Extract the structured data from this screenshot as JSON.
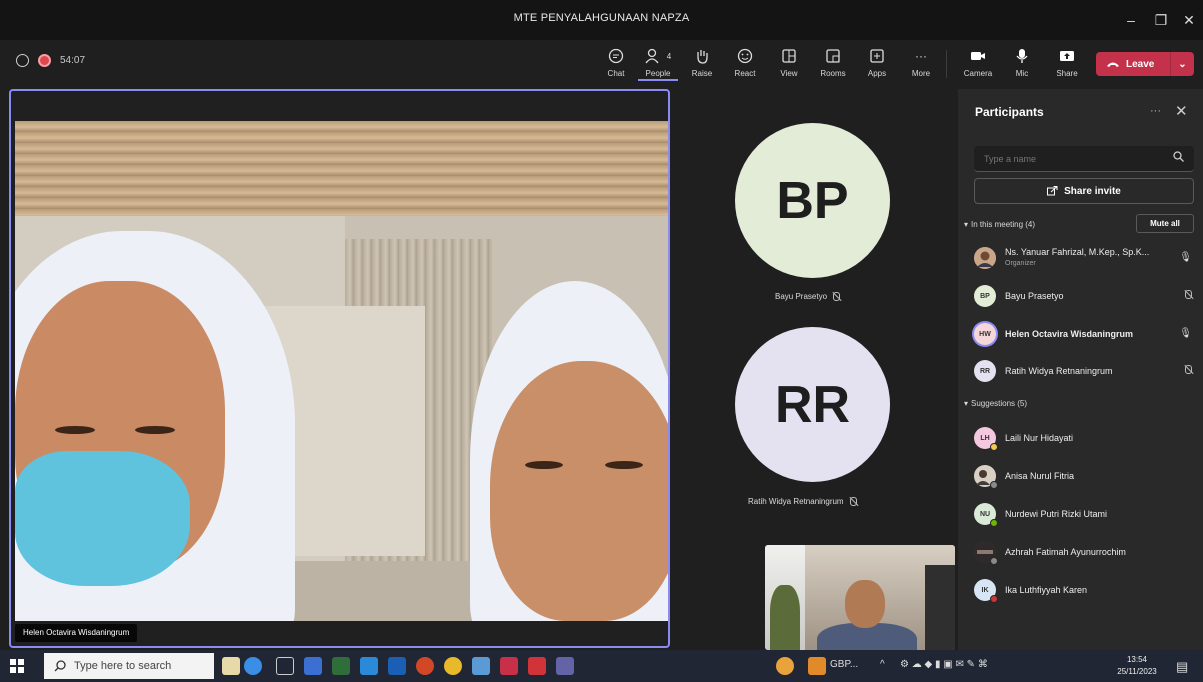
{
  "window": {
    "title": "MTE PENYALAHGUNAAN NAPZA",
    "minimize": "–",
    "maximize": "❐",
    "close": "✕"
  },
  "toolbar": {
    "timer": "54:07",
    "buttons": {
      "chat": "Chat",
      "people": "People",
      "people_count": "4",
      "raise": "Raise",
      "react": "React",
      "view": "View",
      "rooms": "Rooms",
      "apps": "Apps",
      "more": "More",
      "camera": "Camera",
      "mic": "Mic",
      "share": "Share"
    },
    "leave_label": "Leave"
  },
  "stage": {
    "main_speaker": "Helen Octavira Wisdaningrum",
    "tiles": [
      {
        "initials": "BP",
        "name": "Bayu Prasetyo",
        "color": "#e3ecd6"
      },
      {
        "initials": "RR",
        "name": "Ratih Widya Retnaningrum",
        "color": "#e4e2f1"
      }
    ]
  },
  "participants": {
    "title": "Participants",
    "more": "···",
    "close": "✕",
    "search_placeholder": "Type a name",
    "share_invite": "Share invite",
    "in_meeting_label": "In this meeting (4)",
    "mute_all": "Mute all",
    "in_meeting": [
      {
        "initials": "",
        "name": "Ns. Yanuar Fahrizal, M.Kep., Sp.K...",
        "role": "Organizer",
        "mic": "on",
        "avatar_color": "#a77b5a"
      },
      {
        "initials": "BP",
        "name": "Bayu Prasetyo",
        "role": "",
        "mic": "off",
        "avatar_color": "#e3ecd6"
      },
      {
        "initials": "HW",
        "name": "Helen Octavira Wisdaningrum",
        "role": "",
        "mic": "on",
        "avatar_color": "#f5d6d9"
      },
      {
        "initials": "RR",
        "name": "Ratih Widya Retnaningrum",
        "role": "",
        "mic": "off",
        "avatar_color": "#e4e2f1"
      }
    ],
    "suggestions_label": "Suggestions (5)",
    "suggestions": [
      {
        "initials": "LH",
        "name": "Laili Nur Hidayati",
        "avatar_color": "#f4c8df",
        "status_color": "#f2c94c"
      },
      {
        "initials": "",
        "name": "Anisa Nurul Fitria",
        "avatar_color": "#7b6a58",
        "status_color": "#8a8a8a"
      },
      {
        "initials": "NU",
        "name": "Nurdewi Putri Rizki Utami",
        "avatar_color": "#d9ead7",
        "status_color": "#6bb700"
      },
      {
        "initials": "",
        "name": "Azhrah Fatimah Ayunurrochim",
        "avatar_color": "#5a4a44",
        "status_color": "#8a8a8a"
      },
      {
        "initials": "IK",
        "name": "Ika Luthfiyyah Karen",
        "avatar_color": "#d7e6f5",
        "status_color": "#d13438"
      }
    ]
  },
  "taskbar": {
    "search_placeholder": "Type here to search",
    "weather": "GBP...",
    "time": "13:54",
    "date": "25/11/2023"
  },
  "colors": {
    "accent": "#8b8cf3",
    "leave": "#c4314b",
    "recording": "#e0464e"
  }
}
